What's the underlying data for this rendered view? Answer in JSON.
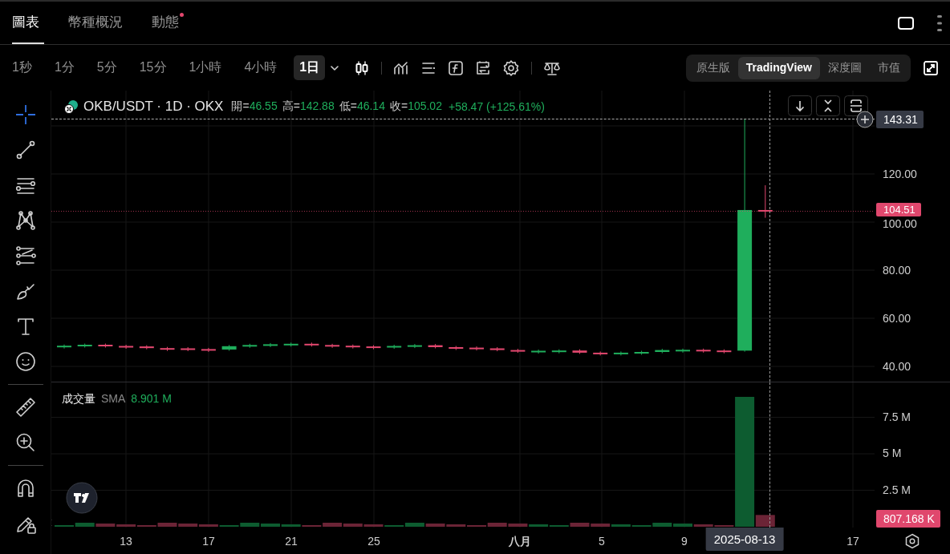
{
  "tabs": [
    {
      "label": "圖表",
      "selected": true,
      "has_notification": false
    },
    {
      "label": "幣種概況",
      "selected": false,
      "has_notification": false
    },
    {
      "label": "動態",
      "selected": false,
      "has_notification": true
    }
  ],
  "intervals": [
    {
      "label": "1秒",
      "selected": false
    },
    {
      "label": "1分",
      "selected": false
    },
    {
      "label": "5分",
      "selected": false
    },
    {
      "label": "15分",
      "selected": false
    },
    {
      "label": "1小時",
      "selected": false
    },
    {
      "label": "4小時",
      "selected": false
    },
    {
      "label": "1日",
      "selected": true
    }
  ],
  "view_modes": [
    {
      "label": "原生版",
      "selected": false
    },
    {
      "label": "TradingView",
      "selected": true
    },
    {
      "label": "深度圖",
      "selected": false
    },
    {
      "label": "市值",
      "selected": false
    }
  ],
  "legend": {
    "symbol": "OKB/USDT · 1D · OKX",
    "items": [
      {
        "label": "開=",
        "value": "46.55"
      },
      {
        "label": "高=",
        "value": "142.88"
      },
      {
        "label": "低=",
        "value": "46.14"
      },
      {
        "label": "收=",
        "value": "105.02"
      }
    ],
    "change": "+58.47 (+125.61%)"
  },
  "price_axis": {
    "ticks": [
      "120.00",
      "100.00",
      "80.00",
      "60.00",
      "40.00"
    ],
    "crosshair_price": "143.31",
    "last_price": "104.51"
  },
  "volume": {
    "title": "成交量",
    "indicator": "SMA",
    "value": "8.901 M",
    "axis_ticks": [
      "7.5 M",
      "5 M",
      "2.5 M"
    ],
    "last_volume": "807.168 K"
  },
  "time_axis": {
    "ticks": [
      "13",
      "17",
      "21",
      "25",
      "八月",
      "5",
      "9",
      "17"
    ],
    "crosshair_date": "2025-08-13"
  }
}
